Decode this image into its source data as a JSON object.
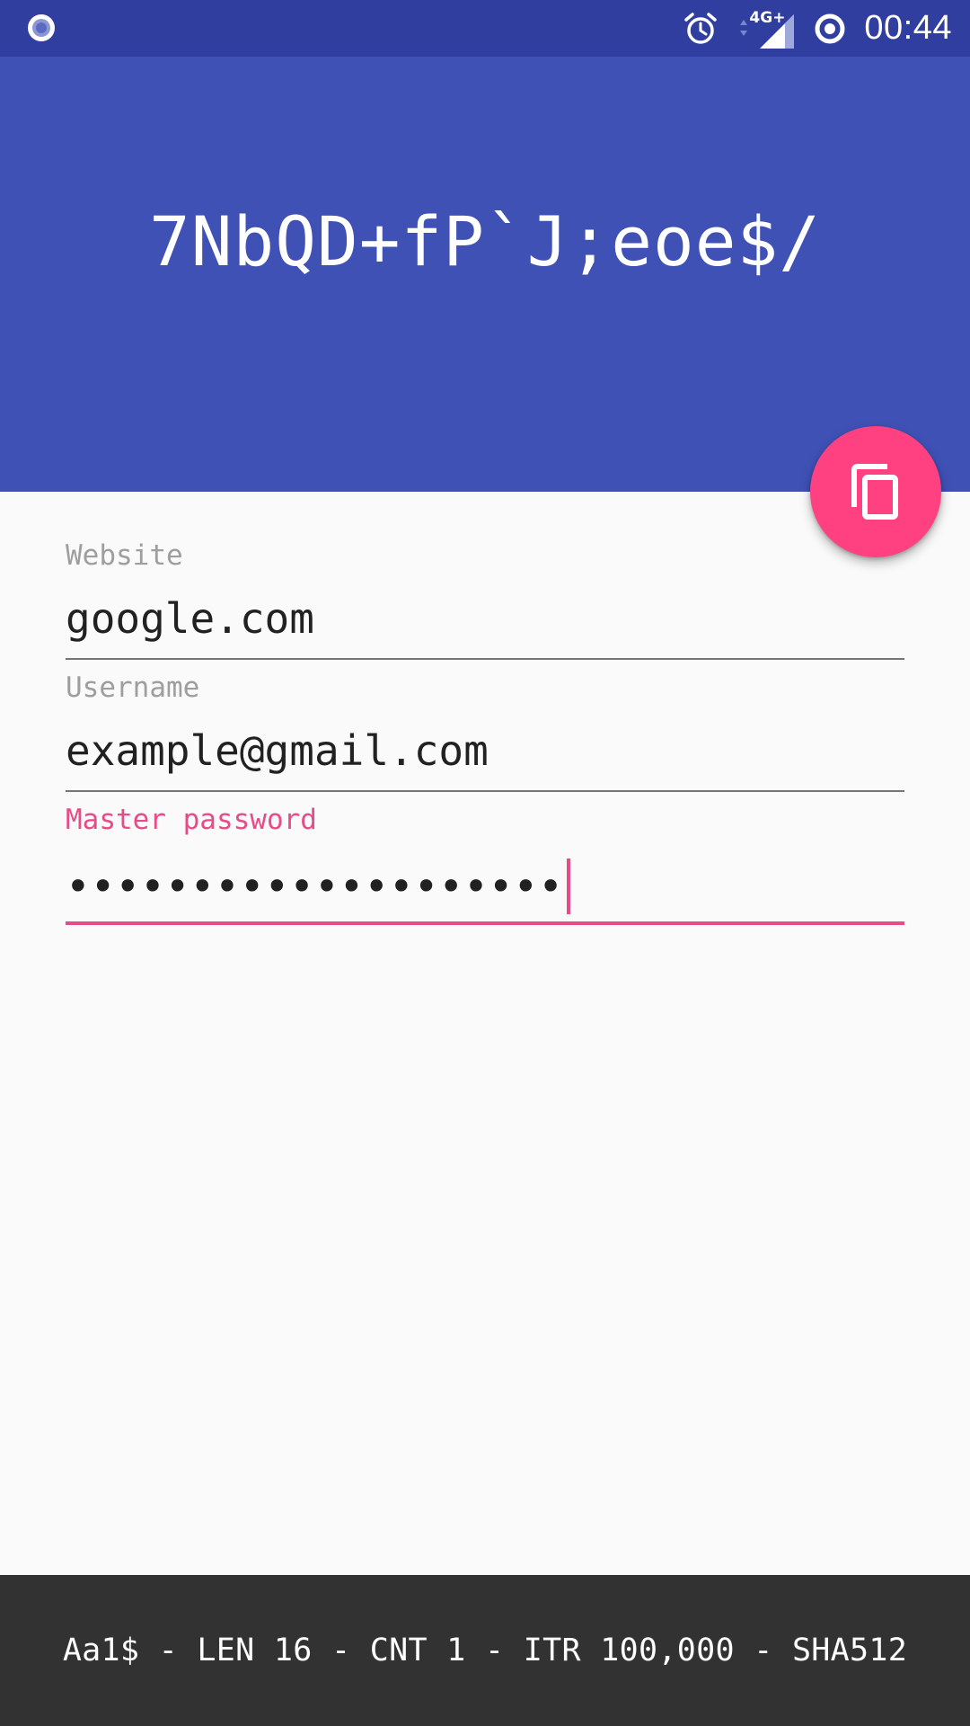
{
  "status_bar": {
    "left_icon": "notification-ring-icon",
    "icons": [
      "alarm-clock-icon",
      "data-arrows-icon",
      "cell-signal-icon",
      "sync-ring-icon"
    ],
    "network": "4G+",
    "time": "00:44"
  },
  "header": {
    "generated_password": "7NbQD+fP`J;eoe$/",
    "background_color": "#3f51b5"
  },
  "fab": {
    "icon": "copy-icon",
    "color": "#ff4081"
  },
  "form": {
    "website": {
      "label": "Website",
      "value": "google.com"
    },
    "username": {
      "label": "Username",
      "value": "example@gmail.com"
    },
    "master_password": {
      "label": "Master password",
      "masked_value": "••••••••••••••••••••"
    }
  },
  "footer": {
    "settings_summary": "Aa1$ - LEN 16 - CNT 1 - ITR 100,000 - SHA512"
  },
  "colors": {
    "primary": "#3f51b5",
    "primary_dark": "#303f9f",
    "accent": "#ff4081",
    "footer_bg": "#323232"
  }
}
